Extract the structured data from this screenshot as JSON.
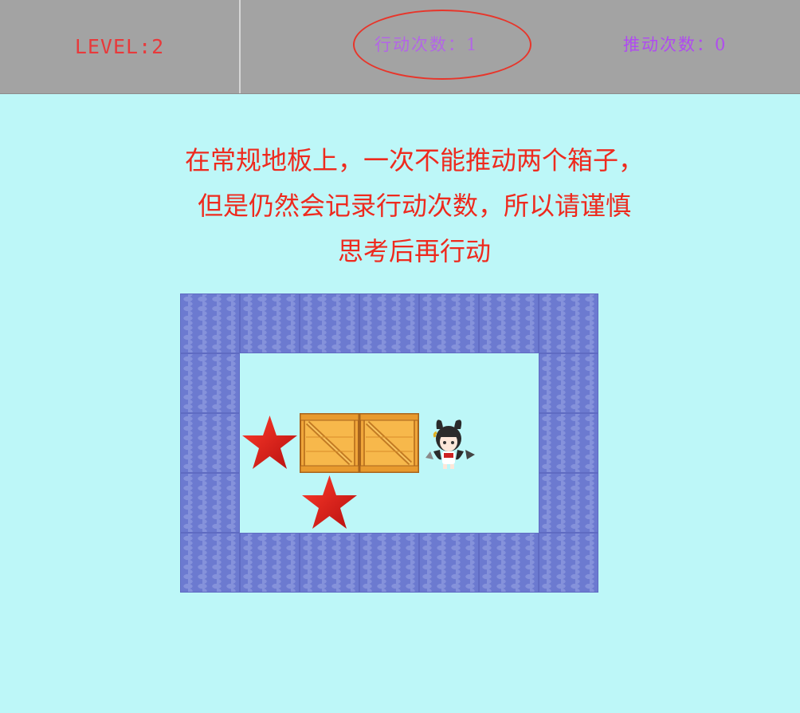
{
  "hud": {
    "level_label": "LEVEL:2",
    "moves_label": "行动次数：",
    "moves_value": "1",
    "pushes_label": "推动次数：",
    "pushes_value": "0"
  },
  "instruction": {
    "lines": [
      "在常规地板上，一次不能推动两个箱子，",
      "但是仍然会记录行动次数，所以请谨慎",
      "思考后再行动"
    ]
  },
  "colors": {
    "level_text": "#e8393b",
    "counter_text": "#b366e6",
    "highlight_oval": "#e8352a",
    "instruction_text": "#ee2a1e",
    "background": "#bdf7f8",
    "wall": "#6c7ad0"
  },
  "board": {
    "cols": 7,
    "rows": 5,
    "map": [
      "WWWWWWW",
      "W.....W",
      "WTBBP.W",
      "W.T...W",
      "WWWWWWW"
    ],
    "legend": {
      "W": "brick-wall",
      ".": "floor",
      "T": "star-target",
      "B": "wooden-crate",
      "P": "player-character"
    }
  }
}
